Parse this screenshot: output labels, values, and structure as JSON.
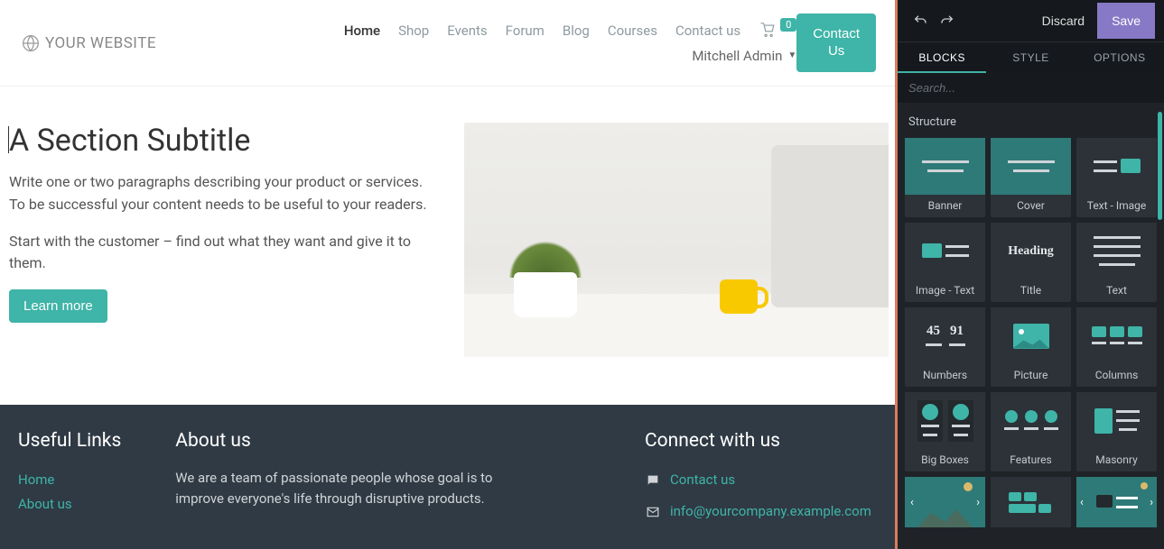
{
  "header": {
    "logo_text": "YOUR WEBSITE",
    "nav": [
      "Home",
      "Shop",
      "Events",
      "Forum",
      "Blog",
      "Courses",
      "Contact us"
    ],
    "active_nav": "Home",
    "cart_count": "0",
    "user_name": "Mitchell Admin",
    "contact_btn_line1": "Contact",
    "contact_btn_line2": "Us"
  },
  "section": {
    "title": "A Section Subtitle",
    "p1": "Write one or two paragraphs describing your product or services. To be successful your content needs to be useful to your readers.",
    "p2": "Start with the customer – find out what they want and give it to them.",
    "learn_more": "Learn more"
  },
  "footer": {
    "links_title": "Useful Links",
    "links": [
      "Home",
      "About us"
    ],
    "about_title": "About us",
    "about_text": "We are a team of passionate people whose goal is to improve everyone's life through disruptive products.",
    "connect_title": "Connect with us",
    "contact_link": "Contact us",
    "email": "info@yourcompany.example.com"
  },
  "editor": {
    "discard": "Discard",
    "save": "Save",
    "tabs": [
      "BLOCKS",
      "STYLE",
      "OPTIONS"
    ],
    "active_tab": "BLOCKS",
    "search_placeholder": "Search...",
    "section_label": "Structure",
    "blocks": [
      "Banner",
      "Cover",
      "Text - Image",
      "Image - Text",
      "Title",
      "Text",
      "Numbers",
      "Picture",
      "Columns",
      "Big Boxes",
      "Features",
      "Masonry"
    ]
  }
}
